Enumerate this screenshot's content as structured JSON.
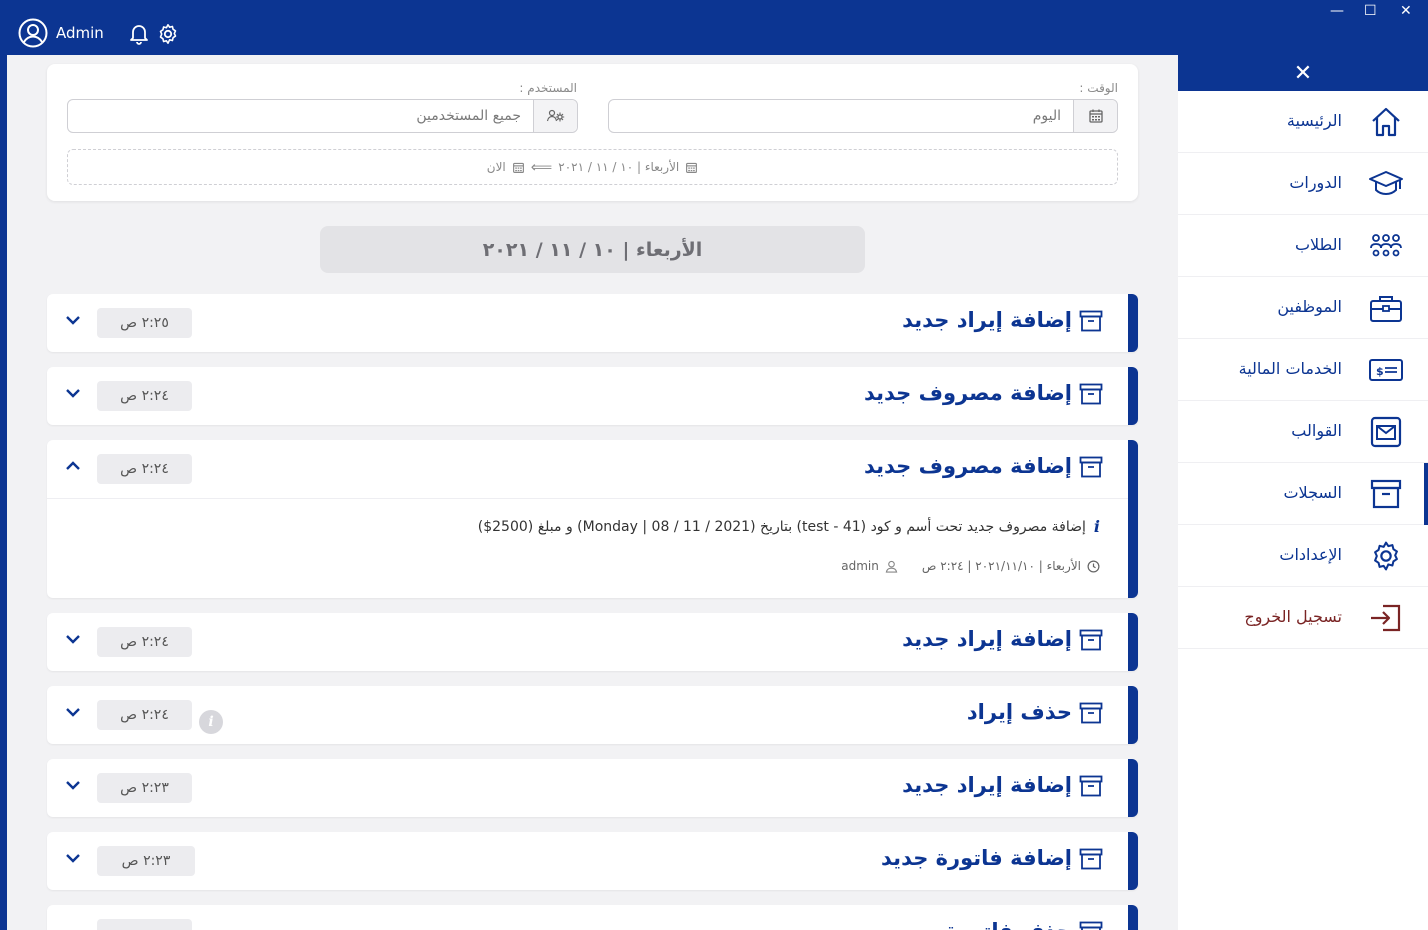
{
  "topbar": {
    "user_label": "Admin",
    "window_buttons": {
      "minimize": "—",
      "maximize": "☐",
      "close": "✕"
    }
  },
  "filters": {
    "time_label": "الوقت :",
    "time_value": "اليوم",
    "user_label": "المستخدم :",
    "user_value": "جميع المستخدمين",
    "range_from": "الأربعاء | ١٠ / ١١ / ٢٠٢١",
    "range_to": "الان",
    "range_arrow": "⟸"
  },
  "date_header": "الأربعاء | ١٠ / ١١ / ٢٠٢١",
  "logs": [
    {
      "title": "إضافة إيراد جديد",
      "time": "٢:٢٥ ص",
      "expanded": false
    },
    {
      "title": "إضافة مصروف جديد",
      "time": "٢:٢٤ ص",
      "expanded": false
    },
    {
      "title": "إضافة مصروف جديد",
      "time": "٢:٢٤ ص",
      "expanded": true,
      "description": "إضافة مصروف جديد تحت أسم و كود (test - 41) بتاريخ (2021 / 11 / 08 | Monday) و مبلغ (2500$)",
      "meta_date": "الأربعاء | ٢٠٢١/١١/١٠ | ٢:٢٤ ص",
      "meta_user": "admin"
    },
    {
      "title": "إضافة إيراد جديد",
      "time": "٢:٢٤ ص",
      "expanded": false
    },
    {
      "title": "حذف إيراد",
      "time": "٢:٢٤ ص",
      "expanded": false,
      "info_badge": "i"
    },
    {
      "title": "إضافة إيراد جديد",
      "time": "٢:٢٣ ص",
      "expanded": false
    },
    {
      "title": "إضافة فاتورة جديد",
      "time": "٢:٢٣ ص",
      "expanded": false
    },
    {
      "title": "حذف فاتورة",
      "time": "",
      "expanded": false
    }
  ],
  "sidebar": {
    "close_label": "✕",
    "items": [
      {
        "label": "الرئيسية",
        "icon": "home-icon"
      },
      {
        "label": "الدورات",
        "icon": "graduation-cap-icon"
      },
      {
        "label": "الطلاب",
        "icon": "students-icon"
      },
      {
        "label": "الموظفين",
        "icon": "briefcase-icon"
      },
      {
        "label": "الخدمات المالية",
        "icon": "money-icon"
      },
      {
        "label": "القوالب",
        "icon": "mail-icon"
      },
      {
        "label": "السجلات",
        "icon": "archive-icon",
        "active": true
      },
      {
        "label": "الإعدادات",
        "icon": "gear-icon"
      },
      {
        "label": "تسجيل الخروج",
        "icon": "logout-icon"
      }
    ]
  },
  "colors": {
    "primary": "#0c3592",
    "logout": "#7a2424",
    "background": "#f2f2f4"
  }
}
